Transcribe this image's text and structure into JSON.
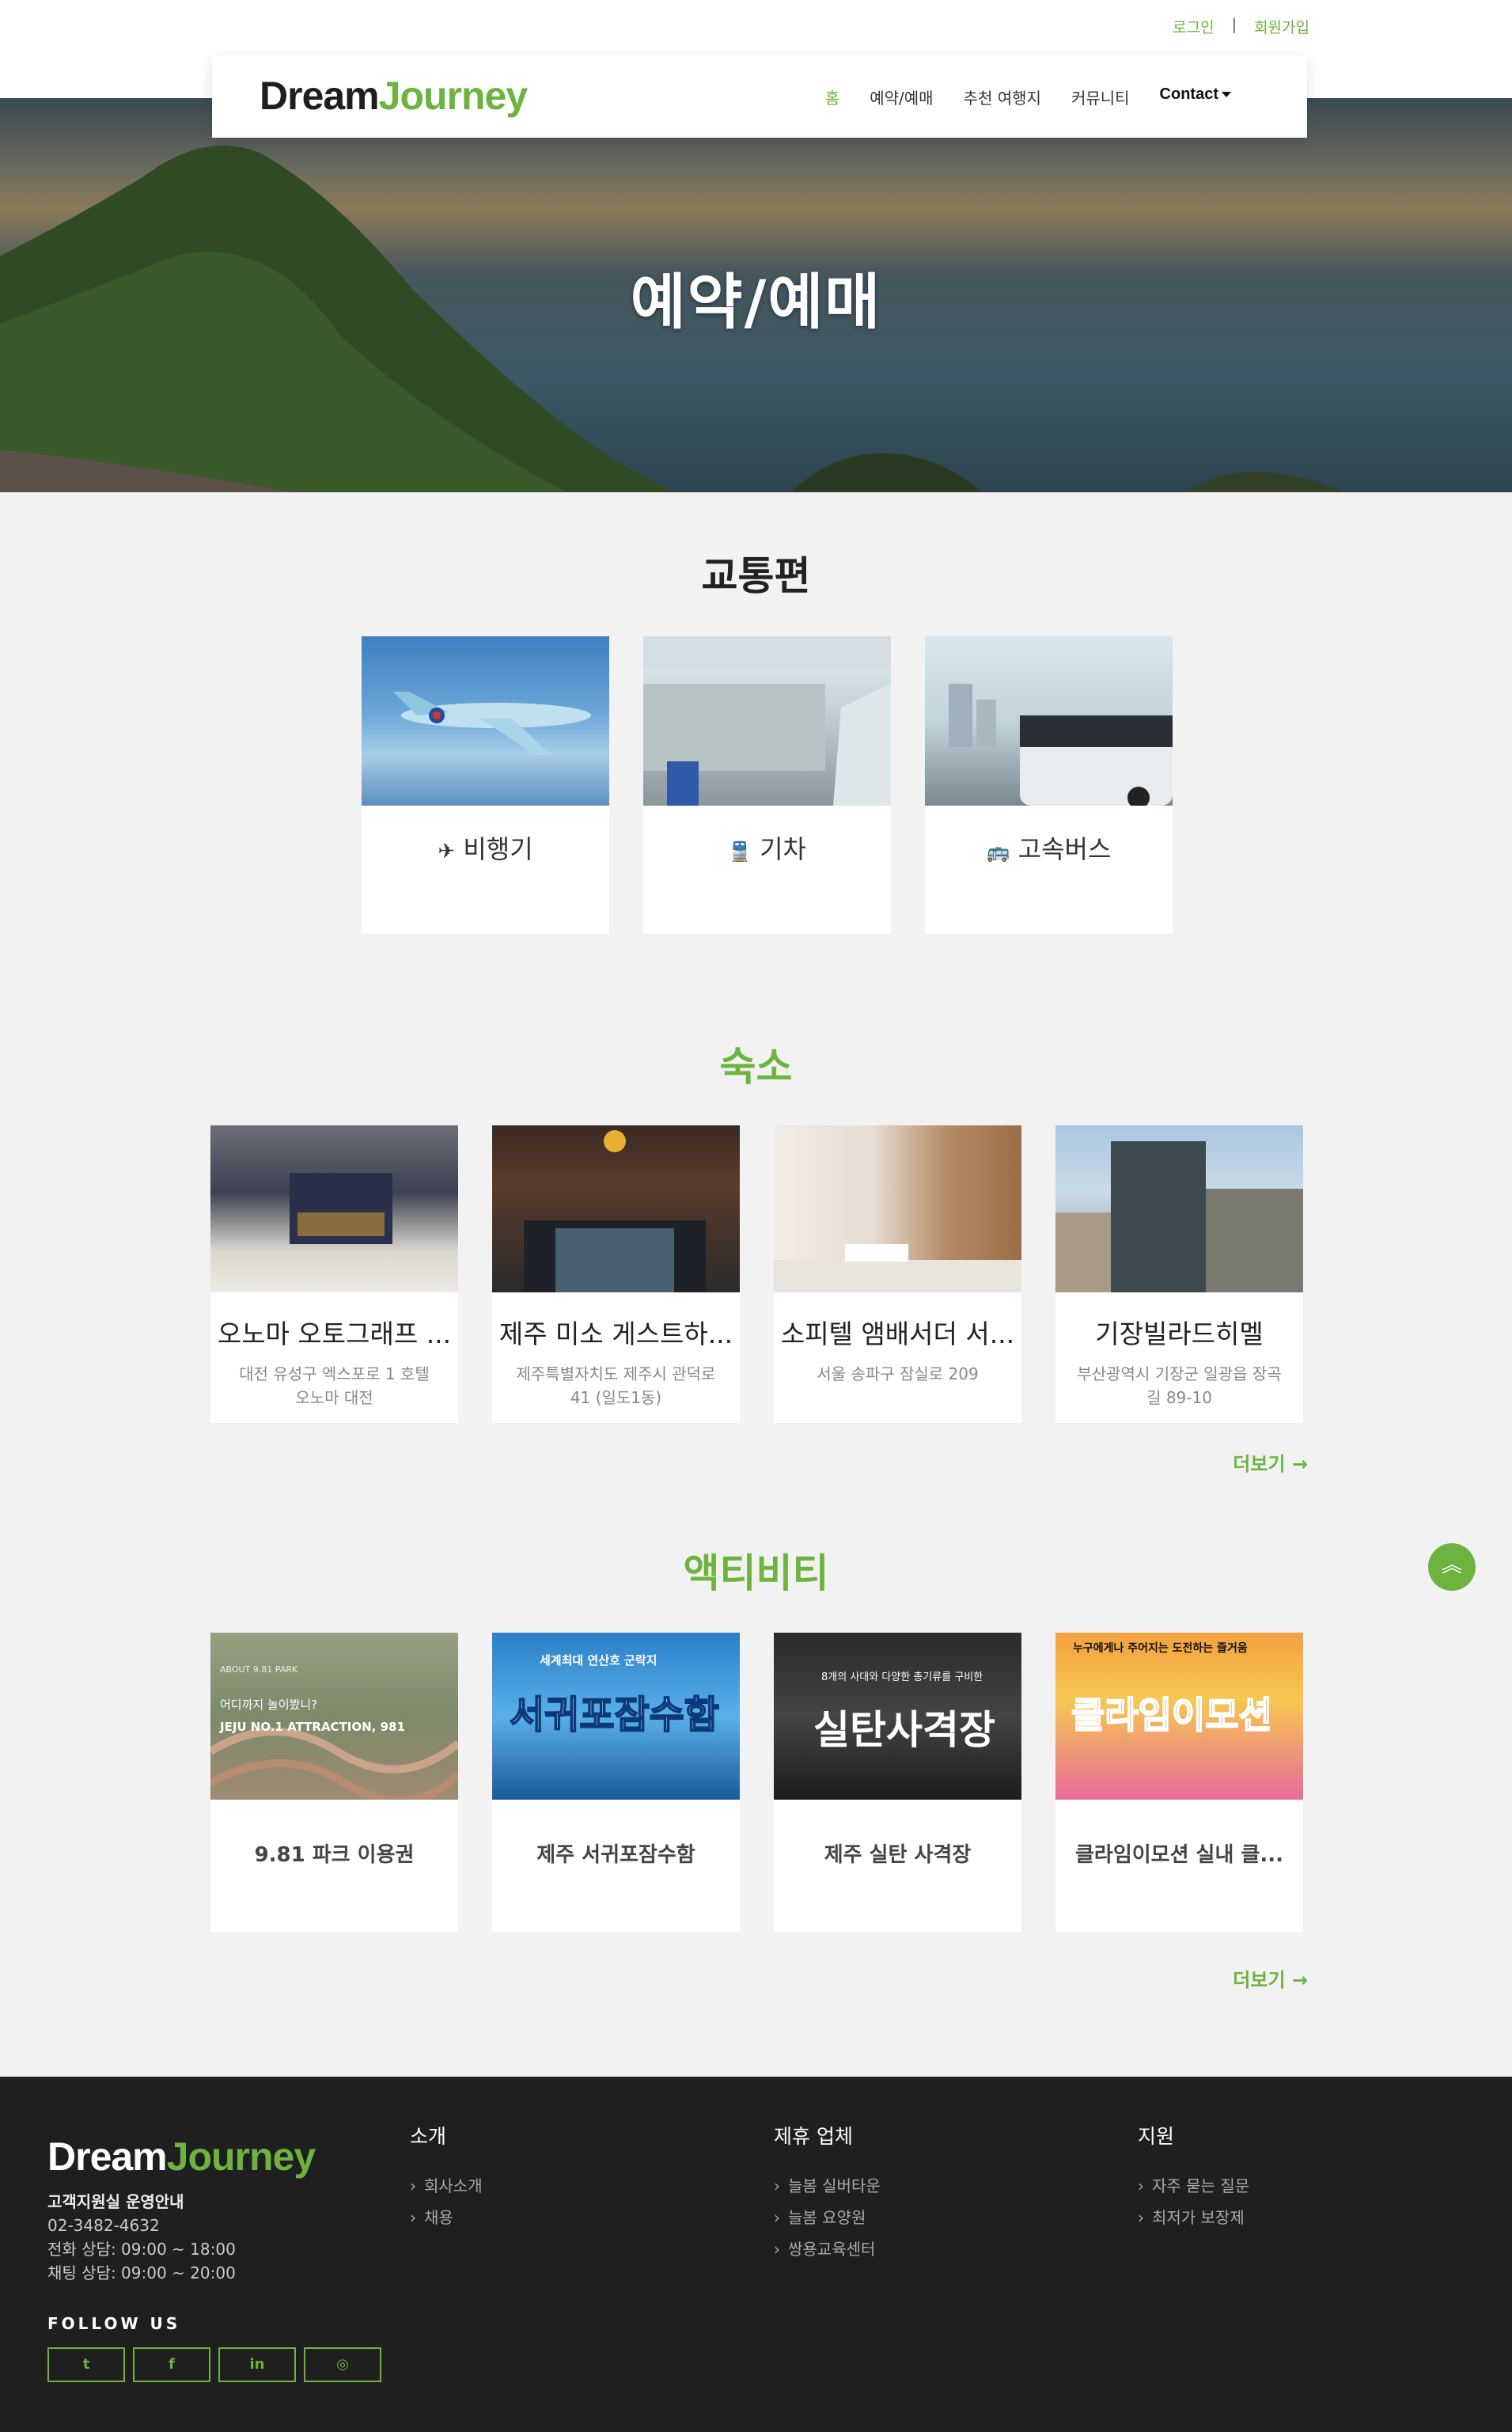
{
  "auth": {
    "login": "로그인",
    "separator": "|",
    "signup": "회원가입"
  },
  "brand": {
    "dream": "Dream",
    "journey": "Journey"
  },
  "nav": {
    "items": [
      "홈",
      "예약/예매",
      "추천 여행지",
      "커뮤니티"
    ],
    "contact": "Contact"
  },
  "hero": {
    "title": "예약/예매"
  },
  "transport": {
    "heading": "교통편",
    "items": [
      {
        "icon": "✈",
        "label": "비행기"
      },
      {
        "icon": "🚆",
        "label": "기차"
      },
      {
        "icon": "🚌",
        "label": "고속버스"
      }
    ]
  },
  "lodging": {
    "heading": "숙소",
    "items": [
      {
        "name": "오노마 오토그래프 ...",
        "address": "대전 유성구 엑스포로 1 호텔 오노마 대전"
      },
      {
        "name": "제주 미소 게스트하...",
        "address": "제주특별자치도 제주시 관덕로 41 (일도1동)"
      },
      {
        "name": "소피텔 앰배서더 서...",
        "address": "서울 송파구 잠실로 209"
      },
      {
        "name": "기장빌라드히멜",
        "address": "부산광역시 기장군 일광읍 장곡길 89-10"
      }
    ],
    "more": "더보기 →"
  },
  "activities": {
    "heading": "액티비티",
    "items": [
      {
        "name": "9.81 파크 이용권",
        "img_text1": "어디까지 놀이봤니?",
        "img_text2": "JEJU NO.1 ATTRACTION, 981",
        "img_text3": "ABOUT 9.81 PARK"
      },
      {
        "name": "제주 서귀포잠수함",
        "img_text1": "서귀포잠수함",
        "img_text2": "세계최대 연산호 군락지"
      },
      {
        "name": "제주 실탄 사격장",
        "img_text1": "실탄사격장",
        "img_text2": "8개의 사대와 다양한 총기류를 구비한"
      },
      {
        "name": "클라임이모션 실내 클...",
        "img_text1": "클라임이모션",
        "img_text2": "누구에게나 주어지는 도전하는 즐거움"
      }
    ],
    "more": "더보기 →"
  },
  "footer": {
    "info_title": "고객지원실 운영안내",
    "phone": "02-3482-4632",
    "call_hours": "전화 상담: 09:00 ~ 18:00",
    "chat_hours": "채팅 상담: 09:00 ~ 20:00",
    "follow": "FOLLOW US",
    "socials": [
      "t",
      "f",
      "in",
      "◎"
    ],
    "cols": [
      {
        "title": "소개",
        "links": [
          "회사소개",
          "채용"
        ]
      },
      {
        "title": "제휴 업체",
        "links": [
          "늘봄 실버타운",
          "늘봄 요양원",
          "쌍용교육센터"
        ]
      },
      {
        "title": "지원",
        "links": [
          "자주 묻는 질문",
          "최저가 보장제"
        ]
      }
    ]
  },
  "colors": {
    "accent": "#6db33f",
    "footer_bg": "#1f1f1f"
  }
}
